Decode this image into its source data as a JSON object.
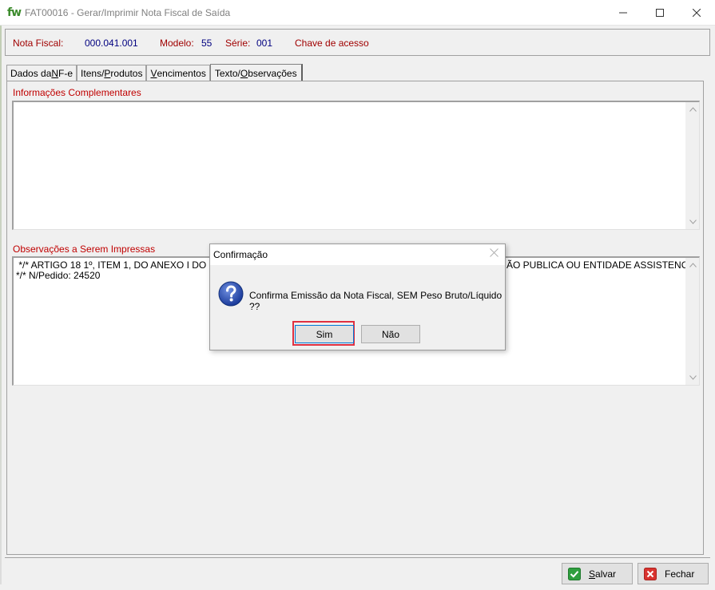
{
  "window": {
    "logo": "fw",
    "title": "FAT00016 - Gerar/Imprimir Nota Fiscal de Saída"
  },
  "header": {
    "nota_label": "Nota Fiscal:",
    "nota_value": "000.041.001",
    "modelo_label": "Modelo:",
    "modelo_value": "55",
    "serie_label": "Série:",
    "serie_value": "001",
    "chave_label": "Chave de acesso"
  },
  "tabs": [
    {
      "pre": "Dados da ",
      "key": "N",
      "post": "F-e"
    },
    {
      "pre": "Itens/",
      "key": "P",
      "post": "rodutos"
    },
    {
      "pre": "",
      "key": "V",
      "post": "encimentos"
    },
    {
      "pre": "Texto/",
      "key": "O",
      "post": "bservações"
    }
  ],
  "sections": {
    "info_label": "Informações Complementares",
    "info_text": "",
    "obs_label": "Observações a Serem Impressas",
    "obs_line1_left": " */* ARTIGO 18 1º, ITEM 1, DO ANEXO I DO RICM",
    "obs_line1_right": "ÃO PUBLICA OU ENTIDADE ASSISTENCIAL",
    "obs_line2": "*/* N/Pedido: 24520"
  },
  "dialog": {
    "title": "Confirmação",
    "message": "Confirma Emissão da Nota Fiscal, SEM Peso Bruto/Líquido ??",
    "yes": "Sim",
    "no": "Não"
  },
  "footer": {
    "save_key": "S",
    "save_rest": "alvar",
    "close_label": "Fechar"
  },
  "colors": {
    "label_red": "#a00000",
    "value_blue": "#000080",
    "highlight": "#e03040"
  }
}
